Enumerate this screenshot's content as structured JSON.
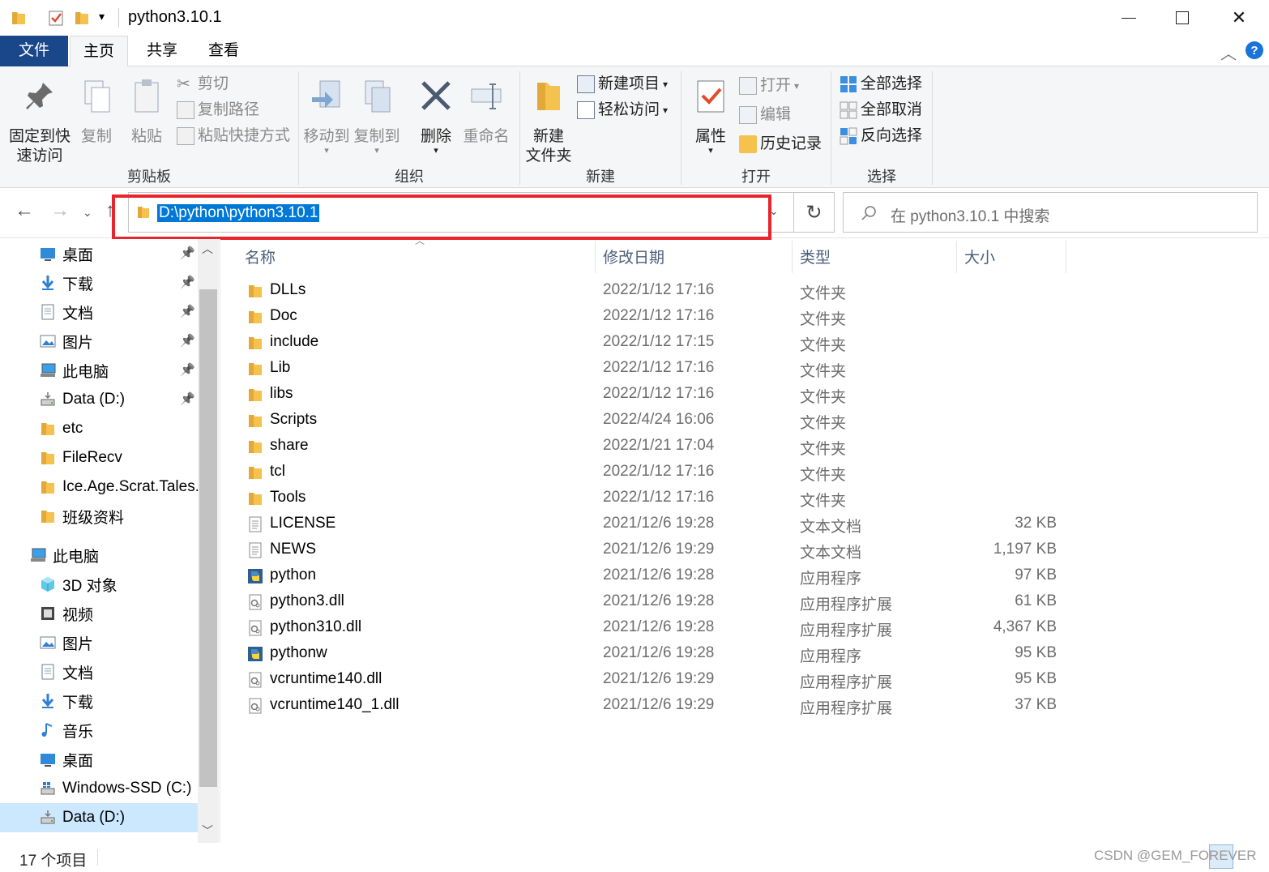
{
  "window": {
    "title": "python3.10.1",
    "controls": [
      "minimize",
      "maximize",
      "close"
    ]
  },
  "tabs": {
    "file": "文件",
    "home": "主页",
    "share": "共享",
    "view": "查看"
  },
  "ribbon": {
    "clipboard": {
      "label": "剪贴板",
      "pin": "固定到快\n速访问",
      "copy": "复制",
      "paste": "粘贴",
      "cut": "剪切",
      "copy_path": "复制路径",
      "paste_shortcut": "粘贴快捷方式"
    },
    "organize": {
      "label": "组织",
      "move_to": "移动到",
      "copy_to": "复制到",
      "delete": "删除",
      "rename": "重命名"
    },
    "new": {
      "label": "新建",
      "new_folder": "新建\n文件夹",
      "new_item": "新建项目",
      "easy_access": "轻松访问"
    },
    "open": {
      "label": "打开",
      "properties": "属性",
      "open": "打开",
      "edit": "编辑",
      "history": "历史记录"
    },
    "select": {
      "label": "选择",
      "select_all": "全部选择",
      "select_none": "全部取消",
      "invert": "反向选择"
    }
  },
  "address": {
    "path": "D:\\python\\python3.10.1",
    "search_placeholder": "在 python3.10.1 中搜索"
  },
  "nav": {
    "quick_access": [
      {
        "label": "桌面",
        "icon": "desktop-icon"
      },
      {
        "label": "下载",
        "icon": "download-icon"
      },
      {
        "label": "文档",
        "icon": "document-icon"
      },
      {
        "label": "图片",
        "icon": "picture-icon"
      },
      {
        "label": "此电脑",
        "icon": "computer-icon"
      },
      {
        "label": "Data (D:)",
        "icon": "drive-icon"
      },
      {
        "label": "etc",
        "icon": "folder-icon"
      },
      {
        "label": "FileRecv",
        "icon": "folder-icon"
      },
      {
        "label": "Ice.Age.Scrat.Tales.S",
        "icon": "folder-icon"
      },
      {
        "label": "班级资料",
        "icon": "folder-icon"
      }
    ],
    "this_pc": "此电脑",
    "this_pc_items": [
      {
        "label": "3D 对象",
        "icon": "3d-objects-icon"
      },
      {
        "label": "视频",
        "icon": "video-icon"
      },
      {
        "label": "图片",
        "icon": "picture-icon"
      },
      {
        "label": "文档",
        "icon": "document-icon"
      },
      {
        "label": "下载",
        "icon": "download-icon"
      },
      {
        "label": "音乐",
        "icon": "music-icon"
      },
      {
        "label": "桌面",
        "icon": "desktop-icon"
      },
      {
        "label": "Windows-SSD (C:)",
        "icon": "windows-drive-icon"
      },
      {
        "label": "Data (D:)",
        "icon": "drive-icon"
      }
    ]
  },
  "columns": {
    "name": "名称",
    "date": "修改日期",
    "type": "类型",
    "size": "大小"
  },
  "files": [
    {
      "name": "DLLs",
      "date": "2022/1/12 17:16",
      "type": "文件夹",
      "size": "",
      "icon": "folder"
    },
    {
      "name": "Doc",
      "date": "2022/1/12 17:16",
      "type": "文件夹",
      "size": "",
      "icon": "folder"
    },
    {
      "name": "include",
      "date": "2022/1/12 17:15",
      "type": "文件夹",
      "size": "",
      "icon": "folder"
    },
    {
      "name": "Lib",
      "date": "2022/1/12 17:16",
      "type": "文件夹",
      "size": "",
      "icon": "folder"
    },
    {
      "name": "libs",
      "date": "2022/1/12 17:16",
      "type": "文件夹",
      "size": "",
      "icon": "folder"
    },
    {
      "name": "Scripts",
      "date": "2022/4/24 16:06",
      "type": "文件夹",
      "size": "",
      "icon": "folder"
    },
    {
      "name": "share",
      "date": "2022/1/21 17:04",
      "type": "文件夹",
      "size": "",
      "icon": "folder"
    },
    {
      "name": "tcl",
      "date": "2022/1/12 17:16",
      "type": "文件夹",
      "size": "",
      "icon": "folder"
    },
    {
      "name": "Tools",
      "date": "2022/1/12 17:16",
      "type": "文件夹",
      "size": "",
      "icon": "folder"
    },
    {
      "name": "LICENSE",
      "date": "2021/12/6 19:28",
      "type": "文本文档",
      "size": "32 KB",
      "icon": "text"
    },
    {
      "name": "NEWS",
      "date": "2021/12/6 19:29",
      "type": "文本文档",
      "size": "1,197 KB",
      "icon": "text"
    },
    {
      "name": "python",
      "date": "2021/12/6 19:28",
      "type": "应用程序",
      "size": "97 KB",
      "icon": "exe"
    },
    {
      "name": "python3.dll",
      "date": "2021/12/6 19:28",
      "type": "应用程序扩展",
      "size": "61 KB",
      "icon": "dll"
    },
    {
      "name": "python310.dll",
      "date": "2021/12/6 19:28",
      "type": "应用程序扩展",
      "size": "4,367 KB",
      "icon": "dll"
    },
    {
      "name": "pythonw",
      "date": "2021/12/6 19:28",
      "type": "应用程序",
      "size": "95 KB",
      "icon": "exe"
    },
    {
      "name": "vcruntime140.dll",
      "date": "2021/12/6 19:29",
      "type": "应用程序扩展",
      "size": "95 KB",
      "icon": "dll"
    },
    {
      "name": "vcruntime140_1.dll",
      "date": "2021/12/6 19:29",
      "type": "应用程序扩展",
      "size": "37 KB",
      "icon": "dll"
    }
  ],
  "status": {
    "count": "17 个项目"
  },
  "watermark": "CSDN @GEM_FOREVER",
  "colors": {
    "file_tab": "#19478a",
    "selection": "#0078d7",
    "highlight_box": "#e8242c",
    "folder": "#f4c24d"
  }
}
